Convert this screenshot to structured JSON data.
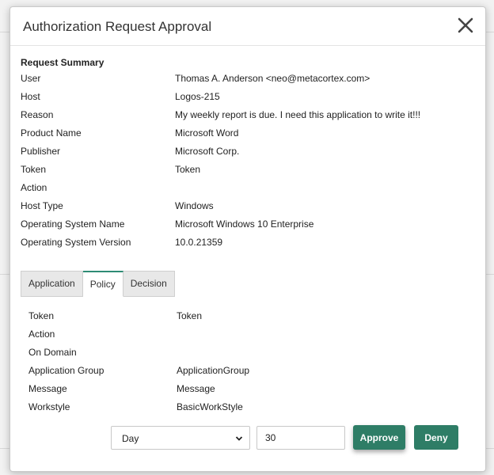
{
  "dialog": {
    "title": "Authorization Request Approval"
  },
  "summary": {
    "heading": "Request Summary",
    "rows": [
      {
        "key": "User",
        "value": "Thomas A. Anderson <neo@metacortex.com>"
      },
      {
        "key": "Host",
        "value": "Logos-215"
      },
      {
        "key": "Reason",
        "value": "My weekly report is due. I need this application to write it!!!"
      },
      {
        "key": "Product Name",
        "value": "Microsoft Word"
      },
      {
        "key": "Publisher",
        "value": "Microsoft Corp."
      },
      {
        "key": "Token",
        "value": "Token"
      },
      {
        "key": "Action",
        "value": ""
      },
      {
        "key": "Host Type",
        "value": "Windows"
      },
      {
        "key": "Operating System Name",
        "value": "Microsoft Windows 10 Enterprise"
      },
      {
        "key": "Operating System Version",
        "value": "10.0.21359"
      }
    ]
  },
  "tabs": {
    "items": [
      {
        "label": "Application"
      },
      {
        "label": "Policy"
      },
      {
        "label": "Decision"
      }
    ],
    "active": "Policy"
  },
  "policy": {
    "rows": [
      {
        "key": "Token",
        "value": "Token"
      },
      {
        "key": "Action",
        "value": ""
      },
      {
        "key": "On Domain",
        "value": ""
      },
      {
        "key": "Application Group",
        "value": "ApplicationGroup"
      },
      {
        "key": "Message",
        "value": "Message"
      },
      {
        "key": "Workstyle",
        "value": "BasicWorkStyle"
      }
    ]
  },
  "footer": {
    "duration_unit": "Day",
    "duration_value": "30",
    "approve_label": "Approve",
    "deny_label": "Deny"
  },
  "colors": {
    "accent": "#2e7d66",
    "tab_active_border": "#2e8b74"
  },
  "icons": {
    "close": "close-icon",
    "chevron": "chevron-down-icon"
  }
}
